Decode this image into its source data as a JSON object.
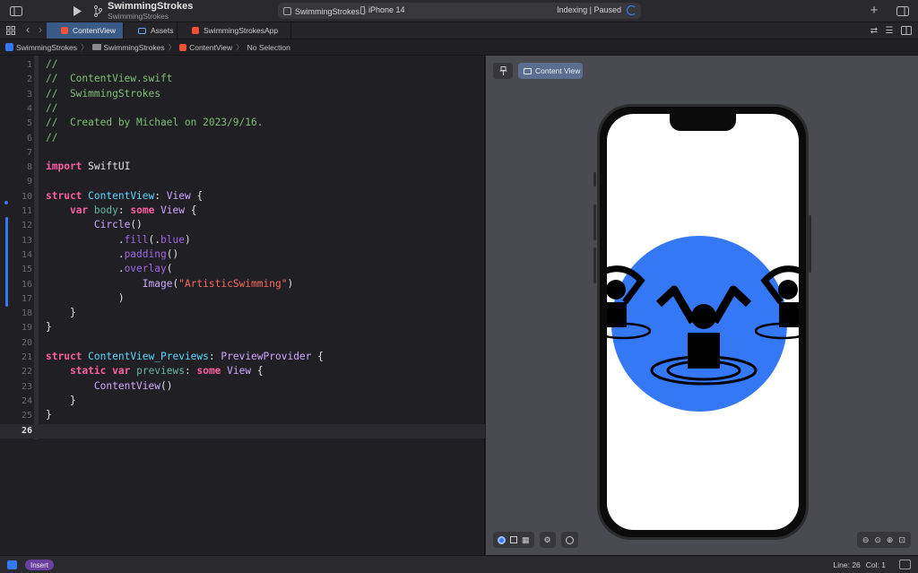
{
  "titlebar": {
    "project_title": "SwimmingStrokes",
    "project_subtitle": "SwimmingStrokes",
    "scheme_target": "SwimmingStrokes",
    "scheme_device": "iPhone 14",
    "status_text": "Indexing | Paused",
    "add_label": "+"
  },
  "tabs": [
    {
      "label": "ContentView",
      "icon": "swift-file-icon",
      "active": true
    },
    {
      "label": "Assets",
      "icon": "asset-catalog-icon",
      "active": false
    },
    {
      "label": "SwimmingStrokesApp",
      "icon": "swift-file-icon",
      "active": false
    }
  ],
  "breadcrumb": [
    "SwimmingStrokes",
    "SwimmingStrokes",
    "ContentView",
    "No Selection"
  ],
  "editor": {
    "lines": [
      {
        "n": "1",
        "html": "<span class='cm'>//</span>"
      },
      {
        "n": "2",
        "html": "<span class='cm'>//  ContentView.swift</span>"
      },
      {
        "n": "3",
        "html": "<span class='cm'>//  SwimmingStrokes</span>"
      },
      {
        "n": "4",
        "html": "<span class='cm'>//</span>"
      },
      {
        "n": "5",
        "html": "<span class='cm'>//  Created by Michael on 2023/9/16.</span>"
      },
      {
        "n": "6",
        "html": "<span class='cm'>//</span>"
      },
      {
        "n": "7",
        "html": ""
      },
      {
        "n": "8",
        "html": "<span class='kw'>import</span> <span class='pl'>SwiftUI</span>"
      },
      {
        "n": "9",
        "html": ""
      },
      {
        "n": "10",
        "html": "<span class='kw'>struct</span> <span class='tyd'>ContentView</span>: <span class='ty'>View</span> {"
      },
      {
        "n": "11",
        "html": "    <span class='kw'>var</span> <span class='vr'>body</span>: <span class='kw'>some</span> <span class='ty'>View</span> {"
      },
      {
        "n": "12",
        "html": "        <span class='ty'>Circle</span>()"
      },
      {
        "n": "13",
        "html": "            .<span class='fn'>fill</span>(.<span class='fn'>blue</span>)"
      },
      {
        "n": "14",
        "html": "            .<span class='fn'>padding</span>()"
      },
      {
        "n": "15",
        "html": "            .<span class='fn'>overlay</span>("
      },
      {
        "n": "16",
        "html": "                <span class='ty'>Image</span>(<span class='st'>\"ArtisticSwimming\"</span>)"
      },
      {
        "n": "17",
        "html": "            )"
      },
      {
        "n": "18",
        "html": "    }"
      },
      {
        "n": "19",
        "html": "}"
      },
      {
        "n": "20",
        "html": ""
      },
      {
        "n": "21",
        "html": "<span class='kw'>struct</span> <span class='tyd'>ContentView_Previews</span>: <span class='ty'>PreviewProvider</span> {"
      },
      {
        "n": "22",
        "html": "    <span class='kw'>static</span> <span class='kw'>var</span> <span class='vr'>previews</span>: <span class='kw'>some</span> <span class='ty'>View</span> {"
      },
      {
        "n": "23",
        "html": "        <span class='ty'>ContentView</span>()"
      },
      {
        "n": "24",
        "html": "    }"
      },
      {
        "n": "25",
        "html": "}"
      },
      {
        "n": "26",
        "html": ""
      }
    ],
    "current_line": "26"
  },
  "canvas": {
    "pin_label": "pin-icon",
    "content_view_label": "Content View",
    "circle_color": "#3478f6"
  },
  "statusbar": {
    "mode": "Insert",
    "line": "Line: 26",
    "col": "Col: 1"
  }
}
